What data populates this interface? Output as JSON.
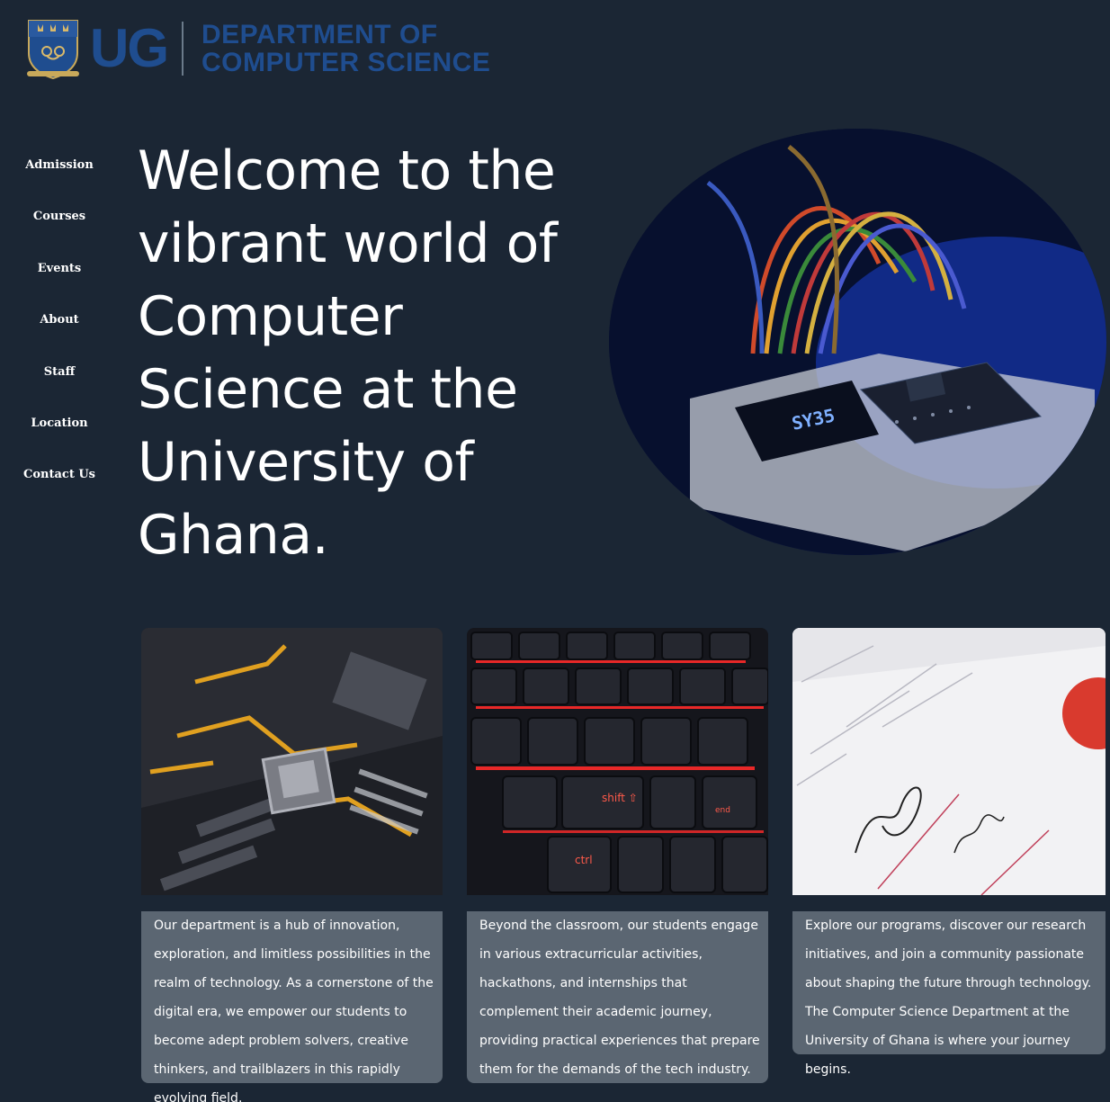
{
  "logo": {
    "crest_icon": "ug-crest-icon",
    "abbreviation": "UG",
    "department_line1": "DEPARTMENT OF",
    "department_line2": "COMPUTER SCIENCE",
    "color": "#1f4d8f"
  },
  "nav": {
    "items": [
      {
        "label": "Admission"
      },
      {
        "label": "Courses"
      },
      {
        "label": "Events"
      },
      {
        "label": "About"
      },
      {
        "label": "Staff"
      },
      {
        "label": "Location"
      },
      {
        "label": "Contact Us"
      }
    ]
  },
  "hero": {
    "title": "Welcome to the vibrant world of Computer Science at the University of Ghana.",
    "image_display_text": "SY35"
  },
  "cards": [
    {
      "image": "motherboard-photo",
      "text": "Our department is a hub of innovation, exploration, and limitless possibilities in the realm of technology. As a cornerstone of the digital era, we empower our students to become adept problem solvers, creative thinkers, and trailblazers in this rapidly evolving field."
    },
    {
      "image": "keyboard-photo",
      "key_labels": [
        "shift ⇧",
        "ctrl",
        "end"
      ],
      "text": "Beyond the classroom, our students engage in various extracurricular activities, hackathons, and internships that complement their academic journey, providing practical experiences that prepare them for the demands of the tech industry."
    },
    {
      "image": "certificate-photo",
      "text": "Explore our programs, discover our research initiatives, and join a community passionate about shaping the future through technology. The Computer Science Department at the University of Ghana is where your journey begins."
    }
  ],
  "colors": {
    "background": "#1b2634",
    "card_text_bg": "#5b6672",
    "text": "#ffffff"
  }
}
